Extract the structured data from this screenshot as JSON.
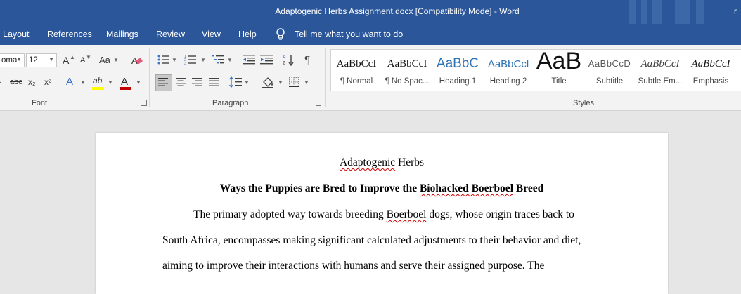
{
  "window": {
    "title": "Adaptogenic Herbs Assignment.docx [Compatibility Mode]  -  Word",
    "user_initial": "r"
  },
  "menu": {
    "items": [
      "Layout",
      "References",
      "Mailings",
      "Review",
      "View",
      "Help"
    ],
    "tell_me": "Tell me what you want to do"
  },
  "font_group": {
    "font_name": "oma",
    "font_size": "12",
    "label": "Font",
    "change_case": "Aa",
    "strikethrough": "abc",
    "subscript": "x₂",
    "superscript": "x²",
    "text_effects": "A",
    "font_color": "A",
    "grow": "A",
    "shrink": "A",
    "highlight": "ab"
  },
  "paragraph_group": {
    "label": "Paragraph",
    "show_marks": "¶"
  },
  "styles_group": {
    "label": "Styles",
    "items": [
      {
        "preview": "AaBbCcI",
        "name": "¶ Normal"
      },
      {
        "preview": "AaBbCcI",
        "name": "¶ No Spac..."
      },
      {
        "preview": "AaBbC",
        "name": "Heading 1"
      },
      {
        "preview": "AaBbCcl",
        "name": "Heading 2"
      },
      {
        "preview": "AaB",
        "name": "Title"
      },
      {
        "preview": "AaBbCcD",
        "name": "Subtitle"
      },
      {
        "preview": "AaBbCcI",
        "name": "Subtle Em..."
      },
      {
        "preview": "AaBbCcI",
        "name": "Emphasis"
      }
    ],
    "colors": {
      "heading": "#2e74b5",
      "subtitle": "#595959"
    }
  },
  "document": {
    "title_part1": "Adaptogenic",
    "title_part2": " Herbs",
    "heading_part1": "Ways the Puppies are Bred to Improve the ",
    "heading_part2": "Biohacked Boerboel",
    "heading_part3": " Breed",
    "p1_part1": "The primary adopted way towards breeding ",
    "p1_part2": "Boerboel",
    "p1_part3": " dogs, whose origin traces back to",
    "line2": "South Africa, encompasses making significant calculated adjustments to their behavior and diet,",
    "line3": "aiming to improve their interactions with humans and serve their assigned purpose. The"
  },
  "colors": {
    "title_bar": "#2b579a",
    "ribbon": "#f3f3f3",
    "canvas": "#e6e6e6",
    "font_color_bar": "#c00000",
    "highlight_bar": "#ffff00",
    "spell_error": "#d00000"
  }
}
